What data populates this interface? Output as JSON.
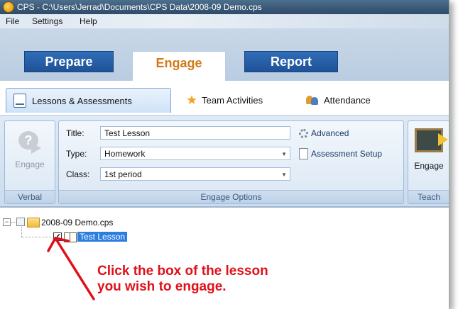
{
  "window": {
    "title": "CPS - C:\\Users\\Jerrad\\Documents\\CPS Data\\2008-09 Demo.cps"
  },
  "menu": [
    "File",
    "Settings",
    "Help"
  ],
  "nav_tabs": [
    {
      "label": "Prepare",
      "active": false
    },
    {
      "label": "Engage",
      "active": true
    },
    {
      "label": "Report",
      "active": false
    }
  ],
  "sub_tabs": [
    {
      "label": "Lessons & Assessments",
      "icon": "document-icon",
      "active": true
    },
    {
      "label": "Team Activities",
      "icon": "star-icon",
      "active": false
    },
    {
      "label": "Attendance",
      "icon": "people-icon",
      "active": false
    }
  ],
  "ribbon": {
    "verbal": {
      "button": "Engage",
      "group": "Verbal"
    },
    "options": {
      "group": "Engage Options",
      "title_label": "Title:",
      "title_value": "Test Lesson",
      "type_label": "Type:",
      "type_value": "Homework",
      "class_label": "Class:",
      "class_value": "1st period",
      "advanced": "Advanced",
      "assessment_setup": "Assessment Setup"
    },
    "teach": {
      "button": "Engage",
      "group": "Teach"
    }
  },
  "tree": {
    "root": {
      "label": "2008-09 Demo.cps",
      "expanded": true,
      "checked": false
    },
    "child": {
      "label": "Test Lesson",
      "checked": true,
      "selected": true
    }
  },
  "annotation": {
    "line1": "Click the box of the lesson",
    "line2": "you wish to engage.",
    "color": "#e0101a"
  }
}
